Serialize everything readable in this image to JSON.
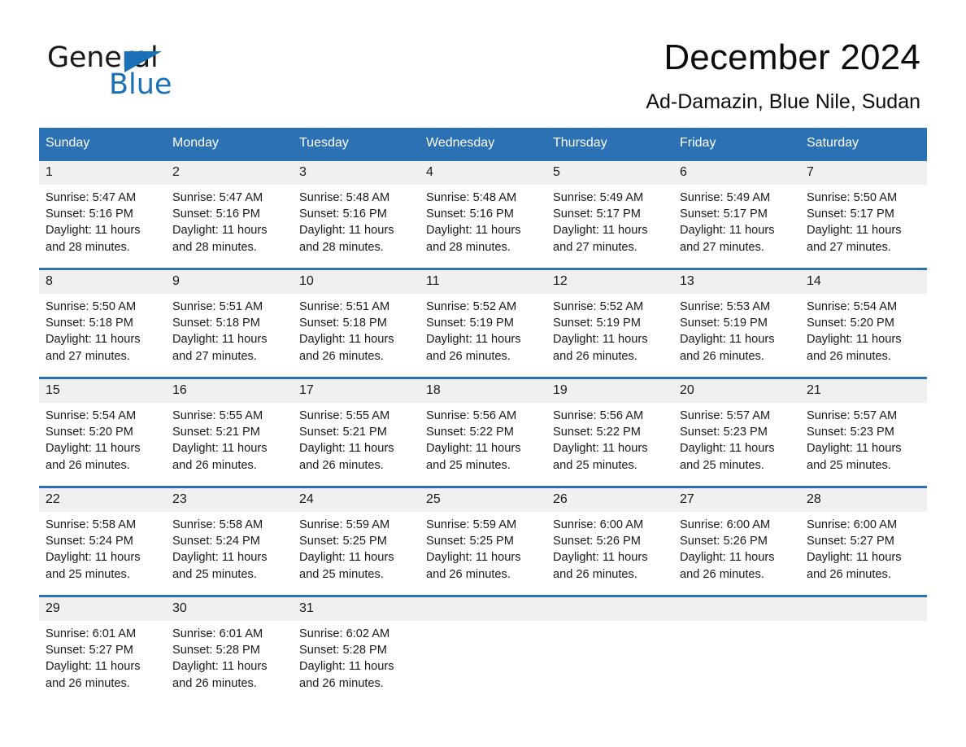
{
  "brand": {
    "name_part1": "General",
    "name_part2": "Blue",
    "triangle_icon": "blue-triangle-icon",
    "accent_color": "#1a71b8"
  },
  "header": {
    "title": "December 2024",
    "location": "Ad-Damazin, Blue Nile, Sudan"
  },
  "colors": {
    "header_blue": "#2b71b4",
    "daynum_band": "#f0f0f0",
    "text": "#1a1a1a"
  },
  "weekday_headers": [
    "Sunday",
    "Monday",
    "Tuesday",
    "Wednesday",
    "Thursday",
    "Friday",
    "Saturday"
  ],
  "weeks": [
    [
      {
        "day": "1",
        "sunrise": "Sunrise: 5:47 AM",
        "sunset": "Sunset: 5:16 PM",
        "daylight": "Daylight: 11 hours and 28 minutes."
      },
      {
        "day": "2",
        "sunrise": "Sunrise: 5:47 AM",
        "sunset": "Sunset: 5:16 PM",
        "daylight": "Daylight: 11 hours and 28 minutes."
      },
      {
        "day": "3",
        "sunrise": "Sunrise: 5:48 AM",
        "sunset": "Sunset: 5:16 PM",
        "daylight": "Daylight: 11 hours and 28 minutes."
      },
      {
        "day": "4",
        "sunrise": "Sunrise: 5:48 AM",
        "sunset": "Sunset: 5:16 PM",
        "daylight": "Daylight: 11 hours and 28 minutes."
      },
      {
        "day": "5",
        "sunrise": "Sunrise: 5:49 AM",
        "sunset": "Sunset: 5:17 PM",
        "daylight": "Daylight: 11 hours and 27 minutes."
      },
      {
        "day": "6",
        "sunrise": "Sunrise: 5:49 AM",
        "sunset": "Sunset: 5:17 PM",
        "daylight": "Daylight: 11 hours and 27 minutes."
      },
      {
        "day": "7",
        "sunrise": "Sunrise: 5:50 AM",
        "sunset": "Sunset: 5:17 PM",
        "daylight": "Daylight: 11 hours and 27 minutes."
      }
    ],
    [
      {
        "day": "8",
        "sunrise": "Sunrise: 5:50 AM",
        "sunset": "Sunset: 5:18 PM",
        "daylight": "Daylight: 11 hours and 27 minutes."
      },
      {
        "day": "9",
        "sunrise": "Sunrise: 5:51 AM",
        "sunset": "Sunset: 5:18 PM",
        "daylight": "Daylight: 11 hours and 27 minutes."
      },
      {
        "day": "10",
        "sunrise": "Sunrise: 5:51 AM",
        "sunset": "Sunset: 5:18 PM",
        "daylight": "Daylight: 11 hours and 26 minutes."
      },
      {
        "day": "11",
        "sunrise": "Sunrise: 5:52 AM",
        "sunset": "Sunset: 5:19 PM",
        "daylight": "Daylight: 11 hours and 26 minutes."
      },
      {
        "day": "12",
        "sunrise": "Sunrise: 5:52 AM",
        "sunset": "Sunset: 5:19 PM",
        "daylight": "Daylight: 11 hours and 26 minutes."
      },
      {
        "day": "13",
        "sunrise": "Sunrise: 5:53 AM",
        "sunset": "Sunset: 5:19 PM",
        "daylight": "Daylight: 11 hours and 26 minutes."
      },
      {
        "day": "14",
        "sunrise": "Sunrise: 5:54 AM",
        "sunset": "Sunset: 5:20 PM",
        "daylight": "Daylight: 11 hours and 26 minutes."
      }
    ],
    [
      {
        "day": "15",
        "sunrise": "Sunrise: 5:54 AM",
        "sunset": "Sunset: 5:20 PM",
        "daylight": "Daylight: 11 hours and 26 minutes."
      },
      {
        "day": "16",
        "sunrise": "Sunrise: 5:55 AM",
        "sunset": "Sunset: 5:21 PM",
        "daylight": "Daylight: 11 hours and 26 minutes."
      },
      {
        "day": "17",
        "sunrise": "Sunrise: 5:55 AM",
        "sunset": "Sunset: 5:21 PM",
        "daylight": "Daylight: 11 hours and 26 minutes."
      },
      {
        "day": "18",
        "sunrise": "Sunrise: 5:56 AM",
        "sunset": "Sunset: 5:22 PM",
        "daylight": "Daylight: 11 hours and 25 minutes."
      },
      {
        "day": "19",
        "sunrise": "Sunrise: 5:56 AM",
        "sunset": "Sunset: 5:22 PM",
        "daylight": "Daylight: 11 hours and 25 minutes."
      },
      {
        "day": "20",
        "sunrise": "Sunrise: 5:57 AM",
        "sunset": "Sunset: 5:23 PM",
        "daylight": "Daylight: 11 hours and 25 minutes."
      },
      {
        "day": "21",
        "sunrise": "Sunrise: 5:57 AM",
        "sunset": "Sunset: 5:23 PM",
        "daylight": "Daylight: 11 hours and 25 minutes."
      }
    ],
    [
      {
        "day": "22",
        "sunrise": "Sunrise: 5:58 AM",
        "sunset": "Sunset: 5:24 PM",
        "daylight": "Daylight: 11 hours and 25 minutes."
      },
      {
        "day": "23",
        "sunrise": "Sunrise: 5:58 AM",
        "sunset": "Sunset: 5:24 PM",
        "daylight": "Daylight: 11 hours and 25 minutes."
      },
      {
        "day": "24",
        "sunrise": "Sunrise: 5:59 AM",
        "sunset": "Sunset: 5:25 PM",
        "daylight": "Daylight: 11 hours and 25 minutes."
      },
      {
        "day": "25",
        "sunrise": "Sunrise: 5:59 AM",
        "sunset": "Sunset: 5:25 PM",
        "daylight": "Daylight: 11 hours and 26 minutes."
      },
      {
        "day": "26",
        "sunrise": "Sunrise: 6:00 AM",
        "sunset": "Sunset: 5:26 PM",
        "daylight": "Daylight: 11 hours and 26 minutes."
      },
      {
        "day": "27",
        "sunrise": "Sunrise: 6:00 AM",
        "sunset": "Sunset: 5:26 PM",
        "daylight": "Daylight: 11 hours and 26 minutes."
      },
      {
        "day": "28",
        "sunrise": "Sunrise: 6:00 AM",
        "sunset": "Sunset: 5:27 PM",
        "daylight": "Daylight: 11 hours and 26 minutes."
      }
    ],
    [
      {
        "day": "29",
        "sunrise": "Sunrise: 6:01 AM",
        "sunset": "Sunset: 5:27 PM",
        "daylight": "Daylight: 11 hours and 26 minutes."
      },
      {
        "day": "30",
        "sunrise": "Sunrise: 6:01 AM",
        "sunset": "Sunset: 5:28 PM",
        "daylight": "Daylight: 11 hours and 26 minutes."
      },
      {
        "day": "31",
        "sunrise": "Sunrise: 6:02 AM",
        "sunset": "Sunset: 5:28 PM",
        "daylight": "Daylight: 11 hours and 26 minutes."
      },
      {
        "day": "",
        "sunrise": "",
        "sunset": "",
        "daylight": ""
      },
      {
        "day": "",
        "sunrise": "",
        "sunset": "",
        "daylight": ""
      },
      {
        "day": "",
        "sunrise": "",
        "sunset": "",
        "daylight": ""
      },
      {
        "day": "",
        "sunrise": "",
        "sunset": "",
        "daylight": ""
      }
    ]
  ]
}
